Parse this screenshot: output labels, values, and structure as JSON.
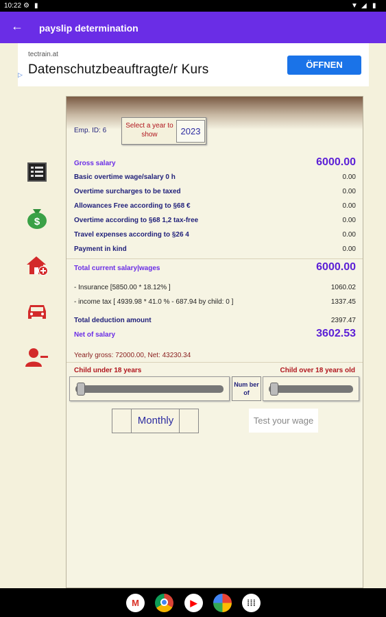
{
  "status_bar": {
    "time": "10:22",
    "icons": [
      "gear-icon",
      "sd-card-icon",
      "wifi-icon",
      "signal-icon",
      "battery-icon"
    ]
  },
  "app_bar": {
    "title": "payslip determination",
    "back_icon": "arrow-left-icon"
  },
  "ad": {
    "source": "tectrain.at",
    "headline": "Datenschutzbeauftragte/r Kurs",
    "button": "ÖFFNEN"
  },
  "sidebar": {
    "icons": [
      "list-icon",
      "money-bag-icon",
      "house-add-icon",
      "car-icon",
      "person-remove-icon"
    ]
  },
  "header": {
    "emp_id": "Emp. ID: 6",
    "year_label": "Select a year to show",
    "year": "2023"
  },
  "rows": {
    "gross": {
      "label": "Gross salary",
      "value": "6000.00"
    },
    "basic_overtime": {
      "label": "Basic overtime wage/salary 0 h",
      "value": "0.00"
    },
    "overtime_surcharges": {
      "label": "Overtime surcharges to be taxed",
      "value": "0.00"
    },
    "allowances": {
      "label": "Allowances Free according to §68 €",
      "value": "0.00"
    },
    "overtime_68": {
      "label": "Overtime according to §68 1,2 tax-free",
      "value": "0.00"
    },
    "travel": {
      "label": "Travel expenses according to §26 4",
      "value": "0.00"
    },
    "payment_kind": {
      "label": "Payment in kind",
      "value": "0.00"
    },
    "total_current": {
      "label": "Total current salary|wages",
      "value": "6000.00"
    },
    "insurance": {
      "label": "- Insurance [5850.00 * 18.12% ]",
      "value": "1060.02"
    },
    "income_tax": {
      "label": "- income tax [ 4939.98 * 41.0 % - 687.94 by child: 0 ]",
      "value": "1337.45"
    },
    "total_deduction": {
      "label": "Total deduction amount",
      "value": "2397.47"
    },
    "net": {
      "label": "Net of salary",
      "value": "3602.53"
    }
  },
  "yearly": "Yearly gross: 72000.00, Net: 43230.34",
  "children": {
    "under_label": "Child under 18 years",
    "over_label": "Child over 18 years old",
    "number_label": "Num ber of",
    "under_value": 0,
    "over_value": 0
  },
  "period": {
    "label": "Monthly"
  },
  "test_button": "Test your wage",
  "dock": {
    "apps": [
      "gmail-icon",
      "chrome-icon",
      "youtube-icon",
      "photos-icon",
      "apps-grid-icon"
    ]
  }
}
